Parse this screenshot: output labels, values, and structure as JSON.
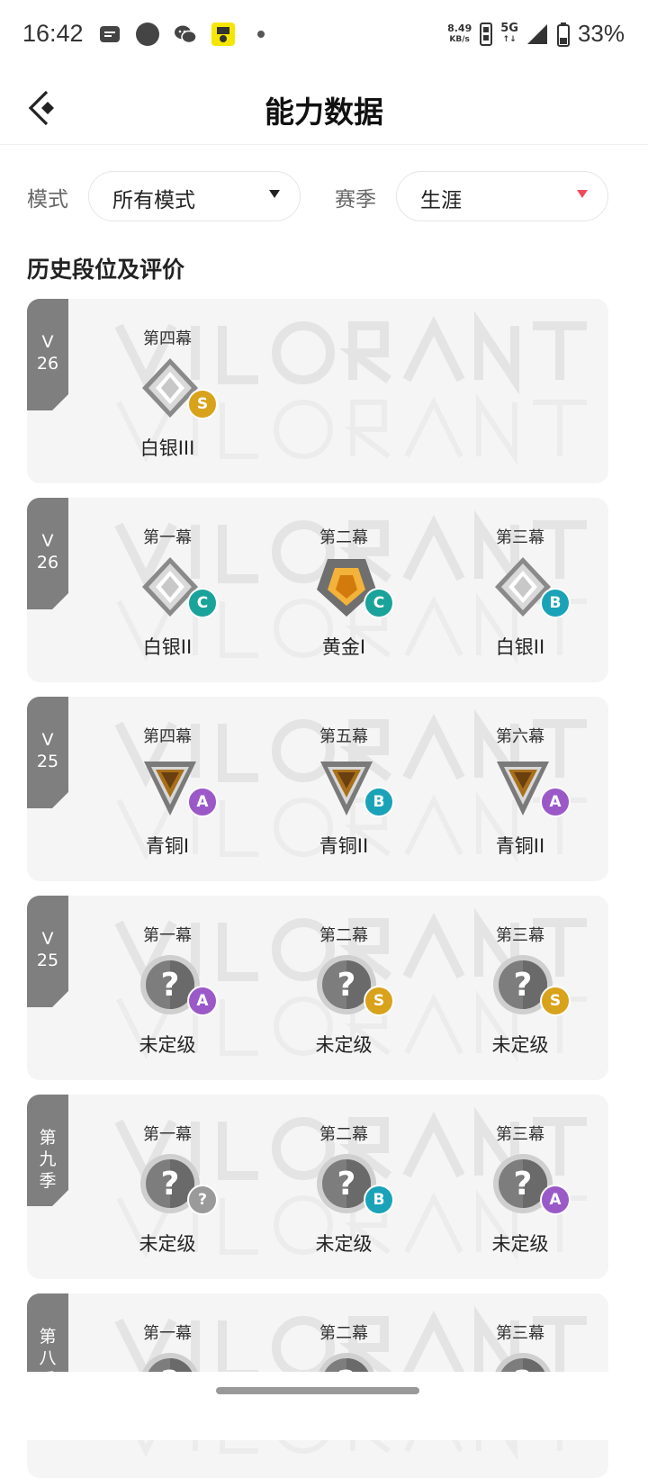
{
  "status_bar": {
    "time": "16:42",
    "net_speed_value": "8.49",
    "net_speed_unit": "KB/s",
    "network": "5G",
    "battery": "33%"
  },
  "header": {
    "title": "能力数据"
  },
  "filters": {
    "mode_label": "模式",
    "mode_value": "所有模式",
    "season_label": "赛季",
    "season_value": "生涯"
  },
  "section_title": "历史段位及评价",
  "colors": {
    "grade_S": "#d9a21b",
    "grade_A": "#9b59c8",
    "grade_B": "#1aa3b8",
    "grade_C": "#1aa39a",
    "grade_unknown": "#9a9a9a",
    "tag_bg": "#7f7f7f"
  },
  "seasons": [
    {
      "tag": "V 26",
      "entries": [
        {
          "act": "第四幕",
          "rank": "白银III",
          "grade": "S",
          "icon": "silver-rank-icon"
        }
      ]
    },
    {
      "tag": "V 26",
      "entries": [
        {
          "act": "第一幕",
          "rank": "白银II",
          "grade": "C",
          "icon": "silver-rank-icon"
        },
        {
          "act": "第二幕",
          "rank": "黄金I",
          "grade": "C",
          "icon": "gold-rank-icon"
        },
        {
          "act": "第三幕",
          "rank": "白银II",
          "grade": "B",
          "icon": "silver-rank-icon"
        }
      ]
    },
    {
      "tag": "V 25",
      "entries": [
        {
          "act": "第四幕",
          "rank": "青铜I",
          "grade": "A",
          "icon": "bronze-rank-icon"
        },
        {
          "act": "第五幕",
          "rank": "青铜II",
          "grade": "B",
          "icon": "bronze-rank-icon"
        },
        {
          "act": "第六幕",
          "rank": "青铜II",
          "grade": "A",
          "icon": "bronze-rank-icon"
        }
      ]
    },
    {
      "tag": "V 25",
      "entries": [
        {
          "act": "第一幕",
          "rank": "未定级",
          "grade": "A",
          "icon": "unranked-icon"
        },
        {
          "act": "第二幕",
          "rank": "未定级",
          "grade": "S",
          "icon": "unranked-icon"
        },
        {
          "act": "第三幕",
          "rank": "未定级",
          "grade": "S",
          "icon": "unranked-icon"
        }
      ]
    },
    {
      "tag": "第九季",
      "entries": [
        {
          "act": "第一幕",
          "rank": "未定级",
          "grade": "?",
          "icon": "unranked-icon"
        },
        {
          "act": "第二幕",
          "rank": "未定级",
          "grade": "B",
          "icon": "unranked-icon"
        },
        {
          "act": "第三幕",
          "rank": "未定级",
          "grade": "A",
          "icon": "unranked-icon"
        }
      ]
    },
    {
      "tag": "第八季",
      "entries": [
        {
          "act": "第一幕",
          "rank": "",
          "grade": "",
          "icon": "unranked-icon"
        },
        {
          "act": "第二幕",
          "rank": "",
          "grade": "",
          "icon": "unranked-icon"
        },
        {
          "act": "第三幕",
          "rank": "",
          "grade": "",
          "icon": "unranked-icon"
        }
      ]
    }
  ]
}
